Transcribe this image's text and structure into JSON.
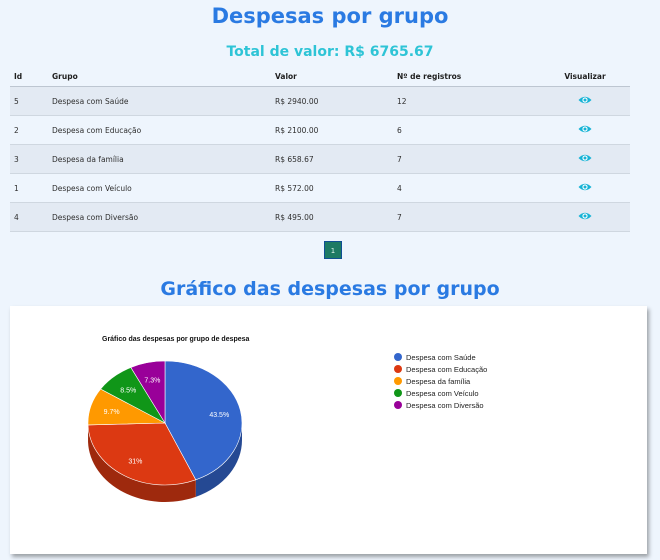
{
  "header": {
    "title": "Despesas por grupo",
    "total": "Total de valor: R$ 6765.67"
  },
  "table": {
    "columns": [
      "Id",
      "Grupo",
      "Valor",
      "Nº de registros",
      "Visualizar"
    ],
    "rows": [
      {
        "id": "5",
        "grupo": "Despesa com Saúde",
        "valor": "R$ 2940.00",
        "registros": "12"
      },
      {
        "id": "2",
        "grupo": "Despesa com Educação",
        "valor": "R$ 2100.00",
        "registros": "6"
      },
      {
        "id": "3",
        "grupo": "Despesa da família",
        "valor": "R$ 658.67",
        "registros": "7"
      },
      {
        "id": "1",
        "grupo": "Despesa com Veículo",
        "valor": "R$ 572.00",
        "registros": "4"
      },
      {
        "id": "4",
        "grupo": "Despesa com Diversão",
        "valor": "R$ 495.00",
        "registros": "7"
      }
    ],
    "view_icon": "eye-icon"
  },
  "pagination": {
    "current_page": "1"
  },
  "chart_section": {
    "heading": "Gráfico das despesas por grupo"
  },
  "chart_data": {
    "type": "pie",
    "title": "Gráfico das despesas por grupo de despesa",
    "three_d": true,
    "legend_position": "right",
    "slices": [
      {
        "label": "Despesa com Saúde",
        "value": 2940.0,
        "percent_label": "43.5%",
        "color": "#3366cc"
      },
      {
        "label": "Despesa com Educação",
        "value": 2100.0,
        "percent_label": "31%",
        "color": "#dc3912"
      },
      {
        "label": "Despesa da família",
        "value": 658.67,
        "percent_label": "9.7%",
        "color": "#ff9900"
      },
      {
        "label": "Despesa com Veículo",
        "value": 572.0,
        "percent_label": "8.5%",
        "color": "#109618"
      },
      {
        "label": "Despesa com Diversão",
        "value": 495.0,
        "percent_label": "7.3%",
        "color": "#990099"
      }
    ]
  },
  "colors": {
    "accent": "#2a7ae2",
    "total": "#2ec4d6",
    "eye_icon": "#17b3d6",
    "pager": "#1d7a64"
  }
}
